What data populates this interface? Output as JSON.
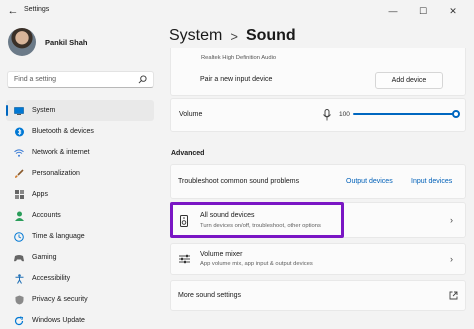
{
  "window": {
    "title": "Settings",
    "back_icon": "back-arrow-icon",
    "controls": [
      "—",
      "☐",
      "✕"
    ]
  },
  "profile": {
    "name": "Pankil Shah"
  },
  "search": {
    "placeholder": "Find a setting",
    "icon": "search-icon"
  },
  "sidebar": {
    "items": [
      {
        "label": "System",
        "icon": "monitor-icon",
        "color": "#0078d4",
        "active": true
      },
      {
        "label": "Bluetooth & devices",
        "icon": "bluetooth-icon",
        "color": "#0078d4"
      },
      {
        "label": "Network & internet",
        "icon": "wifi-icon",
        "color": "#3a7bd5"
      },
      {
        "label": "Personalization",
        "icon": "paintbrush-icon",
        "color": "#d07a2a"
      },
      {
        "label": "Apps",
        "icon": "apps-icon",
        "color": "#555555"
      },
      {
        "label": "Accounts",
        "icon": "person-icon",
        "color": "#2a9d5a"
      },
      {
        "label": "Time & language",
        "icon": "globe-clock-icon",
        "color": "#0078d4"
      },
      {
        "label": "Gaming",
        "icon": "controller-icon",
        "color": "#555555"
      },
      {
        "label": "Accessibility",
        "icon": "accessibility-icon",
        "color": "#1f6fb5"
      },
      {
        "label": "Privacy & security",
        "icon": "shield-icon",
        "color": "#6b6b6b"
      },
      {
        "label": "Windows Update",
        "icon": "update-icon",
        "color": "#0078d4"
      }
    ]
  },
  "header": {
    "section": "System",
    "separator": ">",
    "page": "Sound"
  },
  "main": {
    "realtek_text": "Realtek High Definition Audio",
    "pair_label": "Pair a new input device",
    "add_device_button": "Add device",
    "volume_label": "Volume",
    "volume_value": "100",
    "advanced_title": "Advanced",
    "troubleshoot_label": "Troubleshoot common sound problems",
    "output_devices_link": "Output devices",
    "input_devices_link": "Input devices",
    "all_sound_devices": {
      "title": "All sound devices",
      "subtitle": "Turn devices on/off, troubleshoot, other options"
    },
    "volume_mixer": {
      "title": "Volume mixer",
      "subtitle": "App volume mix, app input & output devices"
    },
    "more_sound_settings": "More sound settings",
    "highlight_color": "#7a16c4",
    "accent": "#0067c0"
  }
}
